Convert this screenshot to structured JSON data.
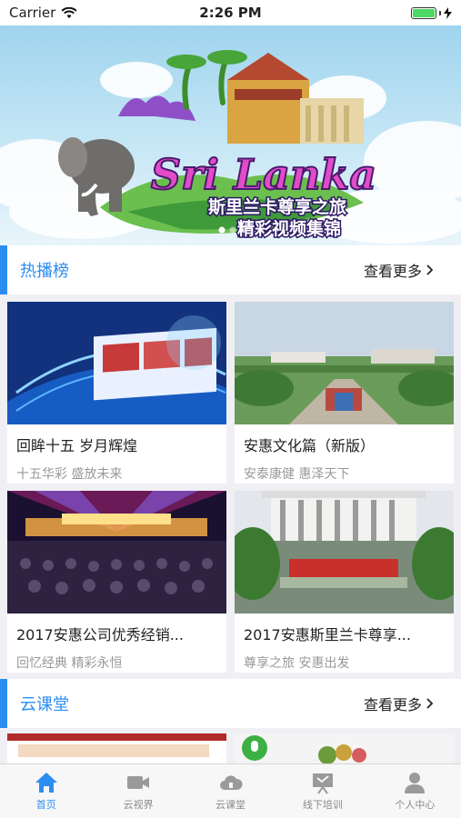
{
  "status_bar": {
    "carrier": "Carrier",
    "time": "2:26 PM",
    "battery_level": 1.0,
    "signal_icon": "wifi-icon"
  },
  "banner": {
    "headline": "Sri Lanka",
    "line1": "斯里兰卡尊享之旅",
    "line2": "精彩视频集锦",
    "page_count": 3,
    "active_page": 1
  },
  "hot_section": {
    "title": "热播榜",
    "more_label": "查看更多",
    "more_icon": "chevron-right-icon",
    "items": [
      {
        "title": "回眸十五 岁月辉煌",
        "subtitle": "十五华彩  盛放未来"
      },
      {
        "title": "安惠文化篇（新版）",
        "subtitle": "安泰康健 惠泽天下"
      },
      {
        "title": "2017安惠公司优秀经销...",
        "subtitle": "回忆经典 精彩永恒"
      },
      {
        "title": "2017安惠斯里兰卡尊享...",
        "subtitle": "尊享之旅 安惠出发"
      }
    ]
  },
  "class_section": {
    "title": "云课堂",
    "more_label": "查看更多",
    "more_icon": "chevron-right-icon"
  },
  "tab_bar": {
    "tabs": [
      {
        "label": "首页",
        "icon": "home-icon",
        "active": true
      },
      {
        "label": "云视界",
        "icon": "video-camera-icon",
        "active": false
      },
      {
        "label": "云课堂",
        "icon": "cloud-icon",
        "active": false
      },
      {
        "label": "线下培训",
        "icon": "presentation-board-icon",
        "active": false
      },
      {
        "label": "个人中心",
        "icon": "user-icon",
        "active": false
      }
    ],
    "active_color": "#2c8df0",
    "inactive_color": "#8a8a8a"
  },
  "colors": {
    "accent": "#2c8df0",
    "battery": "#4cd964"
  }
}
